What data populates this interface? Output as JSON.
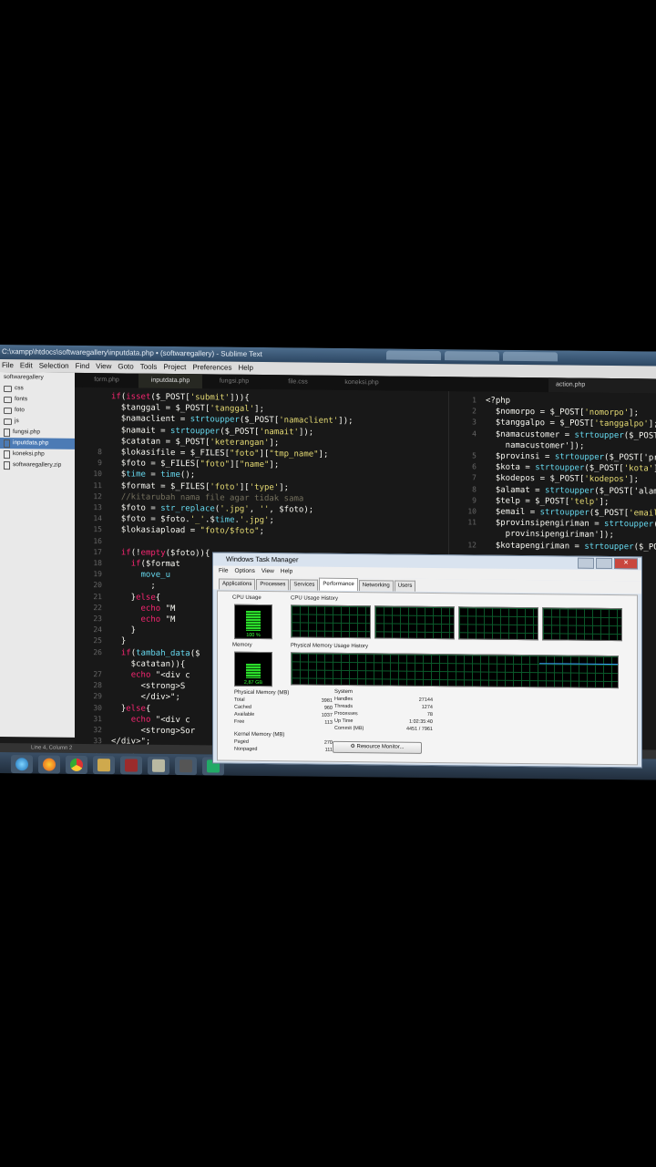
{
  "sublime": {
    "title": "C:\\xampp\\htdocs\\softwaregallery\\inputdata.php • (softwaregallery) - Sublime Text",
    "menu": [
      "File",
      "Edit",
      "Selection",
      "Find",
      "View",
      "Goto",
      "Tools",
      "Project",
      "Preferences",
      "Help"
    ],
    "sidebar": {
      "folders": [
        "css",
        "fonts",
        "foto",
        "js"
      ],
      "root": "softwaregallery",
      "files": [
        "fungsi.php",
        "inputdata.php",
        "koneksi.php",
        "softwaregallery.zip"
      ]
    },
    "tabs": [
      "form.php",
      "inputdata.php",
      "fungsi.php",
      "file.css",
      "koneksi.php"
    ],
    "right_tab": "action.php",
    "status": "Line 4, Column 2"
  },
  "code_left": [
    {
      "n": "",
      "t": "if(isset($_POST['submit'])){"
    },
    {
      "n": "",
      "t": "  $tanggal = $_POST['tanggal'];"
    },
    {
      "n": "",
      "t": "  $namaclient = strtoupper($_POST['namaclient']);"
    },
    {
      "n": "",
      "t": "  $namait = strtoupper($_POST['namait']);"
    },
    {
      "n": "",
      "t": "  $catatan = $_POST['keterangan'];"
    },
    {
      "n": "8",
      "t": "  $lokasifile = $_FILES[\"foto\"][\"tmp_name\"];"
    },
    {
      "n": "9",
      "t": "  $foto = $_FILES[\"foto\"][\"name\"];"
    },
    {
      "n": "10",
      "t": "  $time = time();"
    },
    {
      "n": "11",
      "t": "  $format = $_FILES['foto']['type'];"
    },
    {
      "n": "12",
      "t": "  //kitarubah nama file agar tidak sama"
    },
    {
      "n": "13",
      "t": "  $foto = str_replace('.jpg', '', $foto);"
    },
    {
      "n": "14",
      "t": "  $foto = $foto.'_'.$time.'.jpg';"
    },
    {
      "n": "15",
      "t": "  $lokasiapload = \"foto/$foto\";"
    },
    {
      "n": "16",
      "t": ""
    },
    {
      "n": "17",
      "t": "  if(!empty($foto)){"
    },
    {
      "n": "18",
      "t": "    if($format"
    },
    {
      "n": "19",
      "t": "      move_u"
    },
    {
      "n": "20",
      "t": "        ;"
    },
    {
      "n": "21",
      "t": "    }else{"
    },
    {
      "n": "22",
      "t": "      echo \"M"
    },
    {
      "n": "23",
      "t": "      echo \"M"
    },
    {
      "n": "24",
      "t": "    }"
    },
    {
      "n": "25",
      "t": "  }"
    },
    {
      "n": "26",
      "t": "  if(tambah_data($"
    },
    {
      "n": "",
      "t": "    $catatan)){"
    },
    {
      "n": "27",
      "t": "    echo \"<div c"
    },
    {
      "n": "28",
      "t": "      <strong>S"
    },
    {
      "n": "29",
      "t": "      </div>\";"
    },
    {
      "n": "30",
      "t": "  }else{"
    },
    {
      "n": "31",
      "t": "    echo \"<div c"
    },
    {
      "n": "32",
      "t": "      <strong>Sor"
    },
    {
      "n": "33",
      "t": "</div>\";"
    },
    {
      "n": "34",
      "t": "    }"
    }
  ],
  "code_right": [
    {
      "n": "1",
      "t": "<?php"
    },
    {
      "n": "2",
      "t": "  $nomorpo = $_POST['nomorpo'];"
    },
    {
      "n": "3",
      "t": "  $tanggalpo = $_POST['tanggalpo'];"
    },
    {
      "n": "4",
      "t": "  $namacustomer = strtoupper($_POST["
    },
    {
      "n": "",
      "t": "    namacustomer']);"
    },
    {
      "n": "5",
      "t": "  $provinsi = strtoupper($_POST['prov"
    },
    {
      "n": "6",
      "t": "  $kota = strtoupper($_POST['kota']);"
    },
    {
      "n": "7",
      "t": "  $kodepos = $_POST['kodepos'];"
    },
    {
      "n": "8",
      "t": "  $alamat = strtoupper($_POST['alamat"
    },
    {
      "n": "9",
      "t": "  $telp = $_POST['telp'];"
    },
    {
      "n": "10",
      "t": "  $email = strtoupper($_POST['email'])"
    },
    {
      "n": "11",
      "t": "  $provinsipengiriman = strtoupper($_P"
    },
    {
      "n": "",
      "t": "    provinsipengiriman']);"
    },
    {
      "n": "12",
      "t": "  $kotapengiriman = strtoupper($_POST["
    }
  ],
  "taskmgr": {
    "title": "Windows Task Manager",
    "menu": [
      "File",
      "Options",
      "View",
      "Help"
    ],
    "tabs": [
      "Applications",
      "Processes",
      "Services",
      "Performance",
      "Networking",
      "Users"
    ],
    "active_tab": "Performance",
    "cpu_label": "CPU Usage",
    "cpu_value": "100 %",
    "cpu_fraction": 1.0,
    "cpu_history_label": "CPU Usage History",
    "mem_label": "Memory",
    "mem_value": "2,87 GB",
    "mem_fraction": 0.75,
    "mem_history_label": "Physical Memory Usage History",
    "physical_title": "Physical Memory (MB)",
    "physical": [
      [
        "Total",
        "3981"
      ],
      [
        "Cached",
        "960"
      ],
      [
        "Available",
        "1037"
      ],
      [
        "Free",
        "113"
      ]
    ],
    "kernel_title": "Kernel Memory (MB)",
    "kernel": [
      [
        "Paged",
        "270"
      ],
      [
        "Nonpaged",
        "111"
      ]
    ],
    "system_title": "System",
    "system": [
      [
        "Handles",
        "27144"
      ],
      [
        "Threads",
        "1274"
      ],
      [
        "Processes",
        "78"
      ],
      [
        "Up Time",
        "1:02:35:40"
      ],
      [
        "Commit (MB)",
        "4451 / 7961"
      ]
    ],
    "resource_button": "Resource Monitor..."
  }
}
